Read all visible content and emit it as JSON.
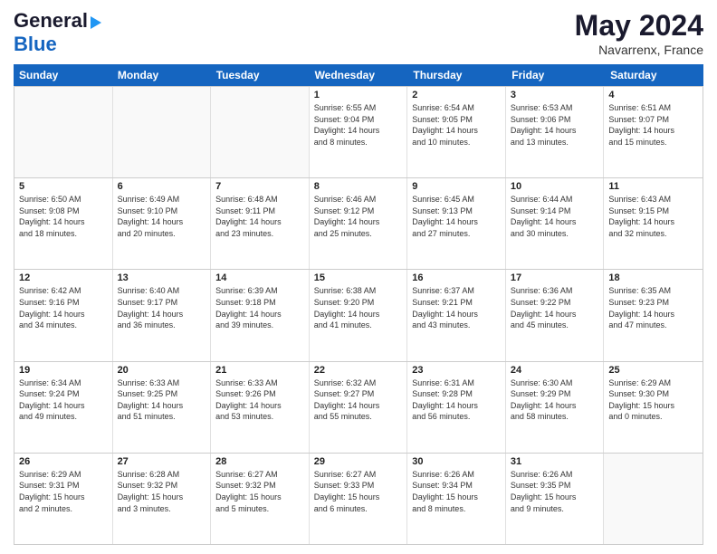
{
  "header": {
    "logo_line1": "General",
    "logo_line2": "Blue",
    "main_title": "May 2024",
    "subtitle": "Navarrenx, France"
  },
  "calendar": {
    "days_of_week": [
      "Sunday",
      "Monday",
      "Tuesday",
      "Wednesday",
      "Thursday",
      "Friday",
      "Saturday"
    ],
    "rows": [
      [
        {
          "day": "",
          "info": ""
        },
        {
          "day": "",
          "info": ""
        },
        {
          "day": "",
          "info": ""
        },
        {
          "day": "1",
          "info": "Sunrise: 6:55 AM\nSunset: 9:04 PM\nDaylight: 14 hours\nand 8 minutes."
        },
        {
          "day": "2",
          "info": "Sunrise: 6:54 AM\nSunset: 9:05 PM\nDaylight: 14 hours\nand 10 minutes."
        },
        {
          "day": "3",
          "info": "Sunrise: 6:53 AM\nSunset: 9:06 PM\nDaylight: 14 hours\nand 13 minutes."
        },
        {
          "day": "4",
          "info": "Sunrise: 6:51 AM\nSunset: 9:07 PM\nDaylight: 14 hours\nand 15 minutes."
        }
      ],
      [
        {
          "day": "5",
          "info": "Sunrise: 6:50 AM\nSunset: 9:08 PM\nDaylight: 14 hours\nand 18 minutes."
        },
        {
          "day": "6",
          "info": "Sunrise: 6:49 AM\nSunset: 9:10 PM\nDaylight: 14 hours\nand 20 minutes."
        },
        {
          "day": "7",
          "info": "Sunrise: 6:48 AM\nSunset: 9:11 PM\nDaylight: 14 hours\nand 23 minutes."
        },
        {
          "day": "8",
          "info": "Sunrise: 6:46 AM\nSunset: 9:12 PM\nDaylight: 14 hours\nand 25 minutes."
        },
        {
          "day": "9",
          "info": "Sunrise: 6:45 AM\nSunset: 9:13 PM\nDaylight: 14 hours\nand 27 minutes."
        },
        {
          "day": "10",
          "info": "Sunrise: 6:44 AM\nSunset: 9:14 PM\nDaylight: 14 hours\nand 30 minutes."
        },
        {
          "day": "11",
          "info": "Sunrise: 6:43 AM\nSunset: 9:15 PM\nDaylight: 14 hours\nand 32 minutes."
        }
      ],
      [
        {
          "day": "12",
          "info": "Sunrise: 6:42 AM\nSunset: 9:16 PM\nDaylight: 14 hours\nand 34 minutes."
        },
        {
          "day": "13",
          "info": "Sunrise: 6:40 AM\nSunset: 9:17 PM\nDaylight: 14 hours\nand 36 minutes."
        },
        {
          "day": "14",
          "info": "Sunrise: 6:39 AM\nSunset: 9:18 PM\nDaylight: 14 hours\nand 39 minutes."
        },
        {
          "day": "15",
          "info": "Sunrise: 6:38 AM\nSunset: 9:20 PM\nDaylight: 14 hours\nand 41 minutes."
        },
        {
          "day": "16",
          "info": "Sunrise: 6:37 AM\nSunset: 9:21 PM\nDaylight: 14 hours\nand 43 minutes."
        },
        {
          "day": "17",
          "info": "Sunrise: 6:36 AM\nSunset: 9:22 PM\nDaylight: 14 hours\nand 45 minutes."
        },
        {
          "day": "18",
          "info": "Sunrise: 6:35 AM\nSunset: 9:23 PM\nDaylight: 14 hours\nand 47 minutes."
        }
      ],
      [
        {
          "day": "19",
          "info": "Sunrise: 6:34 AM\nSunset: 9:24 PM\nDaylight: 14 hours\nand 49 minutes."
        },
        {
          "day": "20",
          "info": "Sunrise: 6:33 AM\nSunset: 9:25 PM\nDaylight: 14 hours\nand 51 minutes."
        },
        {
          "day": "21",
          "info": "Sunrise: 6:33 AM\nSunset: 9:26 PM\nDaylight: 14 hours\nand 53 minutes."
        },
        {
          "day": "22",
          "info": "Sunrise: 6:32 AM\nSunset: 9:27 PM\nDaylight: 14 hours\nand 55 minutes."
        },
        {
          "day": "23",
          "info": "Sunrise: 6:31 AM\nSunset: 9:28 PM\nDaylight: 14 hours\nand 56 minutes."
        },
        {
          "day": "24",
          "info": "Sunrise: 6:30 AM\nSunset: 9:29 PM\nDaylight: 14 hours\nand 58 minutes."
        },
        {
          "day": "25",
          "info": "Sunrise: 6:29 AM\nSunset: 9:30 PM\nDaylight: 15 hours\nand 0 minutes."
        }
      ],
      [
        {
          "day": "26",
          "info": "Sunrise: 6:29 AM\nSunset: 9:31 PM\nDaylight: 15 hours\nand 2 minutes."
        },
        {
          "day": "27",
          "info": "Sunrise: 6:28 AM\nSunset: 9:32 PM\nDaylight: 15 hours\nand 3 minutes."
        },
        {
          "day": "28",
          "info": "Sunrise: 6:27 AM\nSunset: 9:32 PM\nDaylight: 15 hours\nand 5 minutes."
        },
        {
          "day": "29",
          "info": "Sunrise: 6:27 AM\nSunset: 9:33 PM\nDaylight: 15 hours\nand 6 minutes."
        },
        {
          "day": "30",
          "info": "Sunrise: 6:26 AM\nSunset: 9:34 PM\nDaylight: 15 hours\nand 8 minutes."
        },
        {
          "day": "31",
          "info": "Sunrise: 6:26 AM\nSunset: 9:35 PM\nDaylight: 15 hours\nand 9 minutes."
        },
        {
          "day": "",
          "info": ""
        }
      ]
    ]
  }
}
